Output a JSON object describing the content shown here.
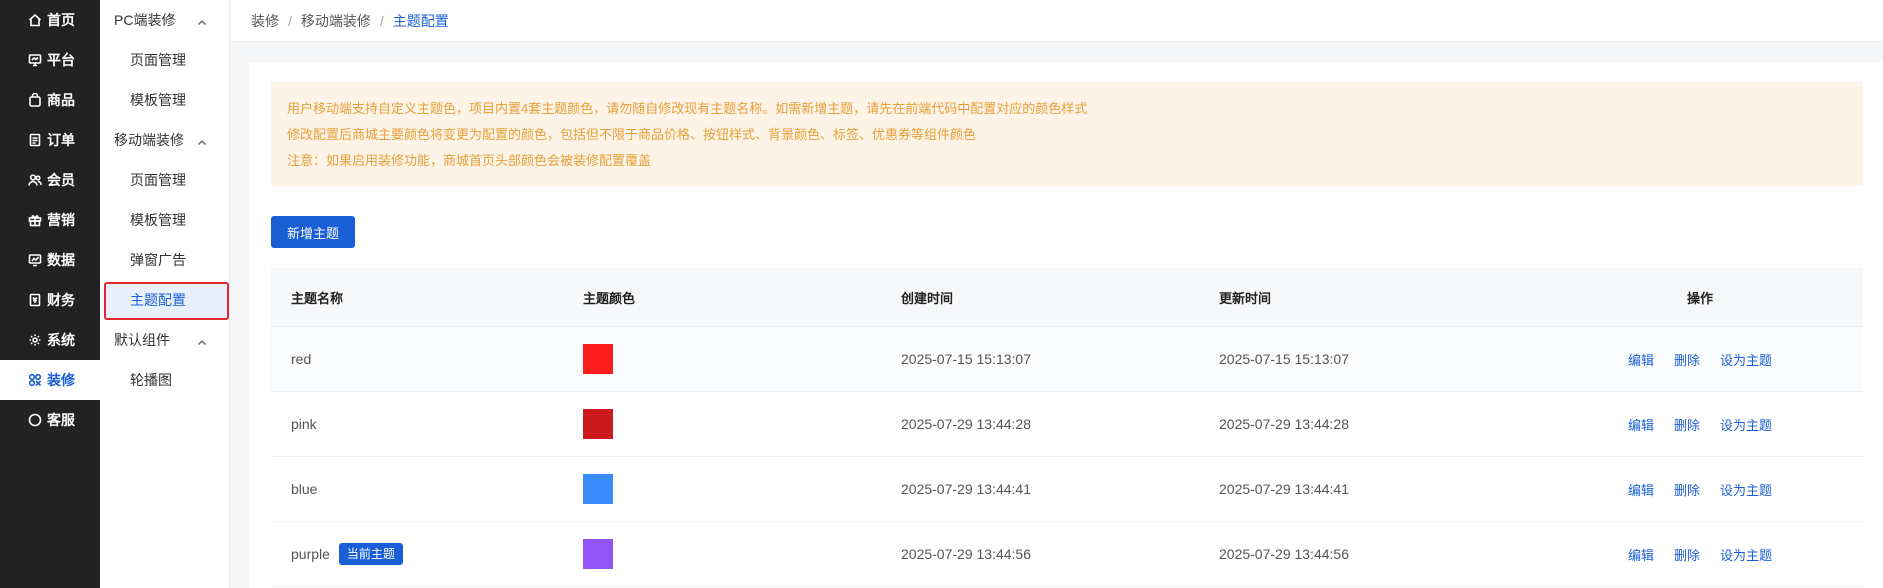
{
  "main_nav": [
    {
      "label": "首页",
      "icon": "home-icon",
      "active": false
    },
    {
      "label": "平台",
      "icon": "monitor-icon",
      "active": false
    },
    {
      "label": "商品",
      "icon": "shopping-bag-icon",
      "active": false
    },
    {
      "label": "订单",
      "icon": "document-icon",
      "active": false
    },
    {
      "label": "会员",
      "icon": "users-icon",
      "active": false
    },
    {
      "label": "营销",
      "icon": "gift-icon",
      "active": false
    },
    {
      "label": "数据",
      "icon": "chart-icon",
      "active": false
    },
    {
      "label": "财务",
      "icon": "ledger-icon",
      "active": false
    },
    {
      "label": "系统",
      "icon": "gear-icon",
      "active": false
    },
    {
      "label": "装修",
      "icon": "palette-icon",
      "active": true
    },
    {
      "label": "客服",
      "icon": "chat-icon",
      "active": false
    }
  ],
  "sub_nav": {
    "pc": {
      "label": "PC端装修",
      "items": [
        "页面管理",
        "模板管理"
      ]
    },
    "mobile": {
      "label": "移动端装修",
      "items": [
        "页面管理",
        "模板管理",
        "弹窗广告",
        "主题配置"
      ]
    },
    "default": {
      "label": "默认组件",
      "items": [
        "轮播图"
      ]
    }
  },
  "breadcrumb": {
    "level1": "装修",
    "level2": "移动端装修",
    "current": "主题配置",
    "separator": "/"
  },
  "notice": {
    "line1": "用户移动端支持自定义主题色，项目内置4套主题颜色，请勿随自修改现有主题名称。如需新增主题，请先在前端代码中配置对应的颜色样式",
    "line2": "修改配置后商城主要颜色将变更为配置的颜色，包括但不限于商品价格、按钮样式、背景颜色、标签、优惠券等组件颜色",
    "line3": "注意：如果启用装修功能，商城首页头部颜色会被装修配置覆盖"
  },
  "add_button": "新增主题",
  "table": {
    "headers": {
      "name": "主题名称",
      "color": "主题颜色",
      "created": "创建时间",
      "updated": "更新时间",
      "ops": "操作"
    },
    "rows": [
      {
        "name": "red",
        "color": "#fd1e1f",
        "created": "2025-07-15 15:13:07",
        "updated": "2025-07-15 15:13:07",
        "badge": ""
      },
      {
        "name": "pink",
        "color": "#cc1a1e",
        "created": "2025-07-29 13:44:28",
        "updated": "2025-07-29 13:44:28",
        "badge": ""
      },
      {
        "name": "blue",
        "color": "#3a8cfb",
        "created": "2025-07-29 13:44:41",
        "updated": "2025-07-29 13:44:41",
        "badge": ""
      },
      {
        "name": "purple",
        "color": "#9455f8",
        "created": "2025-07-29 13:44:56",
        "updated": "2025-07-29 13:44:56",
        "badge": "当前主题"
      }
    ],
    "row_ops": {
      "edit": "编辑",
      "delete": "删除",
      "set_theme": "设为主题"
    }
  },
  "colors": {
    "accent": "#1a5fd6",
    "sidebar_bg": "#222222",
    "notice_bg": "#fdf3e6",
    "notice_text": "#e6a03a",
    "highlight_border": "#e0282e"
  }
}
